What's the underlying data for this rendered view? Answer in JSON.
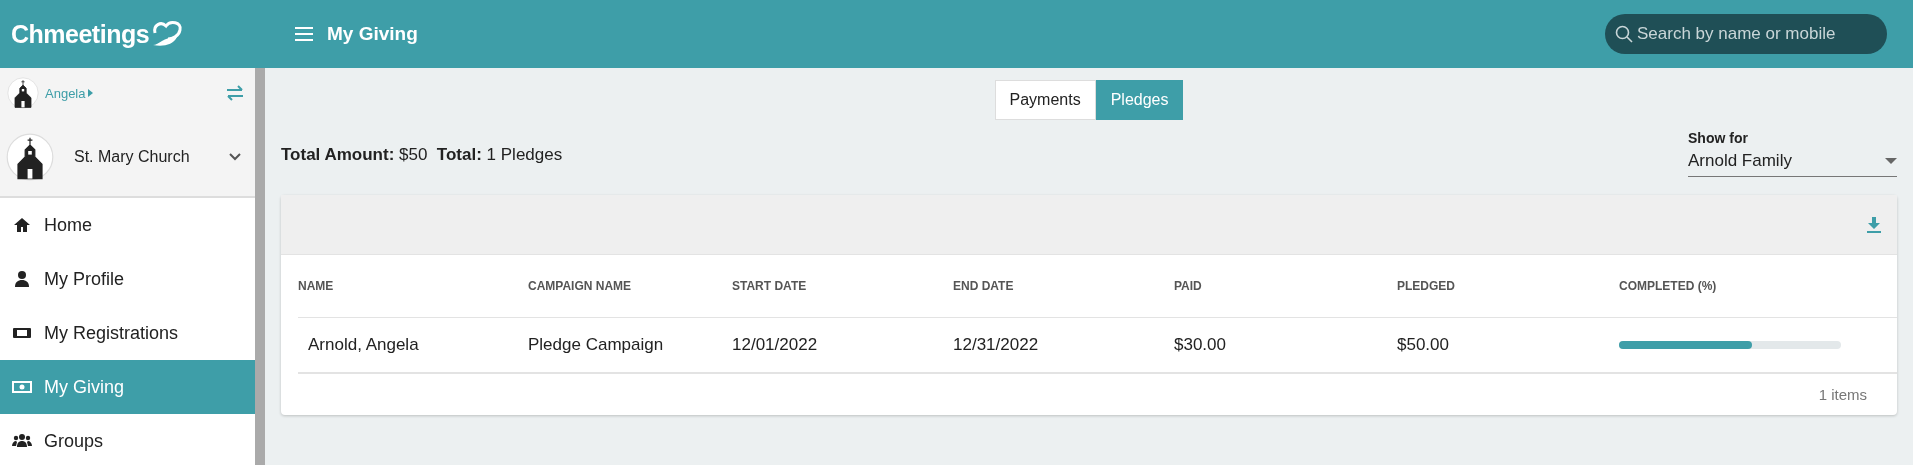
{
  "header": {
    "logo": "Chmeetings",
    "title": "My Giving",
    "search": {
      "placeholder": "Search by name or mobile"
    }
  },
  "sidebar": {
    "user": "Angela",
    "church": "St. Mary Church",
    "items": [
      {
        "label": "Home",
        "kind": "home",
        "selected": false
      },
      {
        "label": "My Profile",
        "kind": "profile",
        "selected": false
      },
      {
        "label": "My Registrations",
        "kind": "registrations",
        "selected": false
      },
      {
        "label": "My Giving",
        "kind": "giving",
        "selected": true
      },
      {
        "label": "Groups",
        "kind": "groups",
        "selected": false
      }
    ]
  },
  "tabs": [
    {
      "label": "Payments",
      "selected": false
    },
    {
      "label": "Pledges",
      "selected": true
    }
  ],
  "totals": "**Total Amount:** $50  **Total:** 1 Pledges",
  "show_for": {
    "label": "Show for",
    "value": "Arnold Family"
  },
  "table": {
    "columns": [
      "NAME",
      "CAMPAIGN NAME",
      "START DATE",
      "END DATE",
      "PAID",
      "PLEDGED",
      "COMPLETED (%)"
    ],
    "rows": [
      {
        "name": "Arnold, Angela",
        "campaign": "Pledge Campaign",
        "start": "12/01/2022",
        "end": "12/31/2022",
        "paid": "$30.00",
        "pledged": "$50.00",
        "level": 0.6
      }
    ],
    "footer": "1 items"
  }
}
